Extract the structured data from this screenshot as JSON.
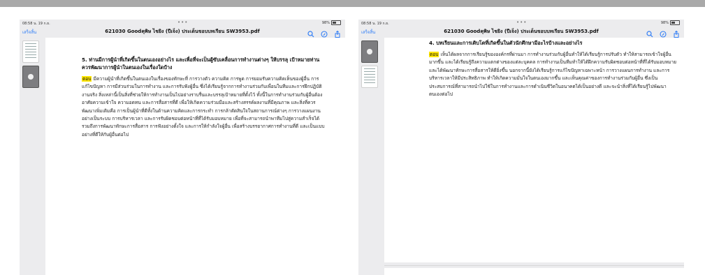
{
  "status": {
    "time": "08:58 น. 19 ก.ย.",
    "battery": "98%"
  },
  "nav": {
    "done_label": "เสร็จสิ้น",
    "doc_title": "621030 Goodคุพิษ ไชยิง (ปีเจ็ง) ประเด็นขอบบทเรียน SW3953.pdf"
  },
  "left_page": {
    "heading": "5. ท่านมีการผู้นำที่เกิดขึ้นในตนเองอย่างไร และเพื่อที่จะเป็นผู้ขับเคลื่อนการทำงานต่างๆ ให้บรรลุ เป้าหมายท่านควรพัฒนาการผู้นำในตนเองในเรื่องใดบ้าง",
    "highlight": "ตอบ",
    "body": "มีความผู้นำที่เกิดขึ้นในตนเองในเรื่องของทักษะที่ การวางตัว ความคิด การพูด การยอมรับความคิดเห็นของผู้อื่น การแก้ไขปัญหา การมีส่วนร่วมในการทำงาน และการรับฟังผู้อื่น ซึ่งได้เรียนรู้จากการทำงานร่วมกับเพื่อนในทีมและการฝึกปฏิบัติงานจริง สิ่งเหล่านี้เป็นสิ่งที่ช่วยให้การทำงานเป็นไปอย่างราบรื่นและบรรลุเป้าหมายที่ตั้งไว้ ทั้งนี้ในการทำงานร่วมกับผู้อื่นต้องอาศัยความเข้าใจ ความอดทน และการสื่อสารที่ดี เพื่อให้เกิดความร่วมมือและสร้างสรรค์ผลงานที่มีคุณภาพ และสิ่งที่ควรพัฒนาเพิ่มเติมคือ การเป็นผู้นำที่ดีทั้งในด้านความคิดและการกระทำ การกล้าตัดสินใจในสถานการณ์ต่างๆ การวางแผนงานอย่างเป็นระบบ การบริหารเวลา และการรับผิดชอบต่อหน้าที่ที่ได้รับมอบหมาย เพื่อที่จะสามารถนำพาทีมไปสู่ความสำเร็จได้ รวมถึงการพัฒนาทักษะการสื่อสาร การฟังอย่างตั้งใจ และการให้กำลังใจผู้อื่น เพื่อสร้างบรรยากาศการทำงานที่ดี และเป็นแบบอย่างที่ดีให้กับผู้อื่นต่อไป"
  },
  "right_page": {
    "heading": "4. บทเรียนและการเติบโตที่เกิดขึ้นในตัวนักศึกษามีอะไรบ้างและอย่างไร",
    "highlight": "ตอบ",
    "body": "เห็นได้ผลจากการเรียนรู้ขององค์กรที่ผ่านมา การทำงานร่วมกับผู้อื่นทำให้ได้เรียนรู้การปรับตัว ทำให้สามารถเข้าใจผู้อื่นมากขึ้น และได้เรียนรู้ถึงความแตกต่างของแต่ละบุคคล การทำงานเป็นทีมทำให้ได้ฝึกความรับผิดชอบต่อหน้าที่ที่ได้รับมอบหมาย และได้พัฒนาทักษะการสื่อสารให้ดียิ่งขึ้น นอกจากนี้ยังได้เรียนรู้การแก้ไขปัญหาเฉพาะหน้า การวางแผนการทำงาน และการบริหารเวลาให้มีประสิทธิภาพ ทำให้เกิดความมั่นใจในตนเองมากขึ้น และเห็นคุณค่าของการทำงานร่วมกับผู้อื่น ซึ่งเป็นประสบการณ์ที่สามารถนำไปใช้ในการทำงานและการดำเนินชีวิตในอนาคตได้เป็นอย่างดี และจะนำสิ่งที่ได้เรียนรู้ไปพัฒนาตนเองต่อไป"
  },
  "colors": {
    "accent": "#2f7df6",
    "highlight": "#ffe600",
    "topbar": "#a9a9a9",
    "viewer_bg": "#ececee"
  },
  "icons": [
    "search-icon",
    "annotate-icon",
    "share-icon",
    "battery-icon"
  ]
}
